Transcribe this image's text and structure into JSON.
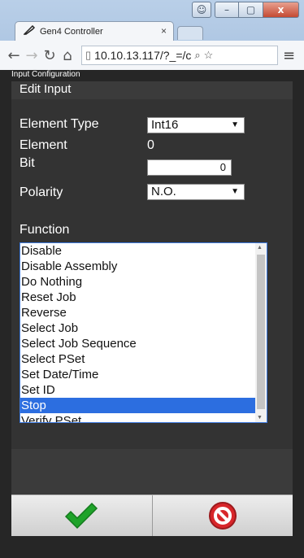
{
  "browser": {
    "tab_title": "Gen4 Controller",
    "tab_close": "×",
    "url": "10.10.13.117/?_=/c",
    "window_buttons": {
      "minimize": "–",
      "maximize": "▢",
      "close": "x"
    }
  },
  "page": {
    "header": "Input Configuration",
    "panel_title": "Edit Input",
    "form": {
      "element_type_label": "Element Type",
      "element_type_value": "Int16",
      "element_label": "Element",
      "element_value": "0",
      "bit_label": "Bit",
      "bit_value": "0",
      "polarity_label": "Polarity",
      "polarity_value": "N.O.",
      "function_label": "Function"
    },
    "functions": [
      "Disable",
      "Disable Assembly",
      "Do Nothing",
      "Reset Job",
      "Reverse",
      "Select Job",
      "Select Job Sequence",
      "Select PSet",
      "Set Date/Time",
      "Set ID",
      "Stop",
      "Verify PSet"
    ],
    "selected_function": "Stop"
  },
  "footer": {
    "ok_icon": "checkmark-icon",
    "cancel_icon": "cancel-icon"
  },
  "colors": {
    "accent": "#2c6ee0",
    "ok": "#1fa32a",
    "cancel": "#d8262a"
  }
}
